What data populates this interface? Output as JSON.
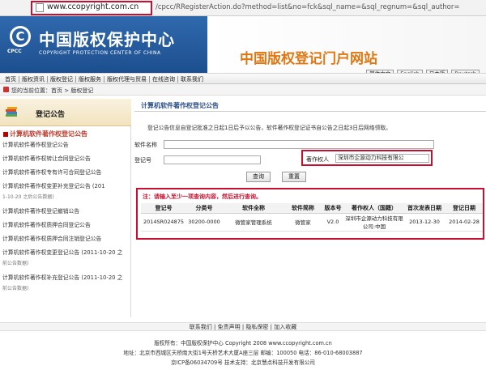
{
  "browser": {
    "url_domain": "www.ccopyright.com.cn",
    "url_rest": "/cpcc/RRegisterAction.do?method=list&no=fck&sql_name=&sql_regnum=&sql_author="
  },
  "banner": {
    "logo_symbol": "C",
    "logo_sub": "CPCC",
    "org_name_cn": "中国版权保护中心",
    "org_name_en": "COPYRIGHT PROTECTION CENTER OF CHINA",
    "portal_title": "中国版权登记门户网站",
    "colors": {
      "banner_blue": "#2f69ad",
      "portal_orange": "#e07712",
      "highlight_red": "#c8102e"
    }
  },
  "nav": {
    "items": [
      "首页",
      "版权资讯",
      "版权登记",
      "版权服务",
      "版权代理与贸易",
      "在线咨询",
      "联系我们"
    ],
    "languages": [
      "简体中文",
      "English",
      "日本語",
      "Deutsch"
    ]
  },
  "breadcrumb": {
    "text": "您的当前位置：首页 > 版权登记"
  },
  "sidebar": {
    "title": "登记公告",
    "section_label": "计算机软件著作权登记公告",
    "items": [
      {
        "label": "计算机软件著作权登记公告",
        "sub": ""
      },
      {
        "label": "计算机软件著作权转让合同登记公告",
        "sub": ""
      },
      {
        "label": "计算机软件著作权专有许可合同登记公告",
        "sub": ""
      },
      {
        "label": "计算机软件著作权变更补充登记公告 (201",
        "sub": "1-10-20 之后公告数据)"
      },
      {
        "label": "计算机软件著作权登记撤销公告",
        "sub": ""
      },
      {
        "label": "计算机软件著作权质押合同登记公告",
        "sub": ""
      },
      {
        "label": "计算机软件著作权质押合同注销登记公告",
        "sub": ""
      },
      {
        "label": "计算机软件著作权变更登记公告 (2011-10-20 之",
        "sub": "前公告数据)"
      },
      {
        "label": "计算机软件著作权补充登记公告 (2011-10-20 之",
        "sub": "前公告数据)"
      }
    ]
  },
  "main": {
    "title": "计算机软件著作权登记公告",
    "notice": "登记公告信息自登记批准之日起1日后予以公告，软件著作权登记证书自公告之日起3日后网络领取。",
    "form": {
      "software_name_label": "软件名称",
      "software_name_value": "",
      "reg_no_label": "登记号",
      "reg_no_value": "",
      "owner_label": "著作权人",
      "owner_value": "深圳市企源动力科技有限公",
      "query_button": "查询",
      "reset_button": "重置"
    },
    "warning": "注：请输入至少一项查询内容，然后进行查询。",
    "table": {
      "headers": [
        "登记号",
        "分类号",
        "软件全称",
        "软件简称",
        "版本号",
        "著作权人（国籍）",
        "首次发表日期",
        "登记日期"
      ],
      "rows": [
        [
          "2014SR024875",
          "30200-0000",
          "微管家管理系统",
          "微管家",
          "V2.0",
          "深圳市企源动力科技有限公司:中国",
          "2013-12-30",
          "2014-02-28"
        ]
      ]
    }
  },
  "footer": {
    "links": "联系我们 | 免责声明 | 隐私保密 | 加入收藏",
    "copyright": "版权所有：中国版权保护中心 Copyright 2008 www.ccopyright.com.cn",
    "address": "地址：北京市西城区天桥南大街1号天桥艺术大厦A座三层  邮编：100050  电话：86-010-68003887",
    "icp": "京ICP备06034709号  技术支持：北京慧点科技开发有限公司"
  }
}
